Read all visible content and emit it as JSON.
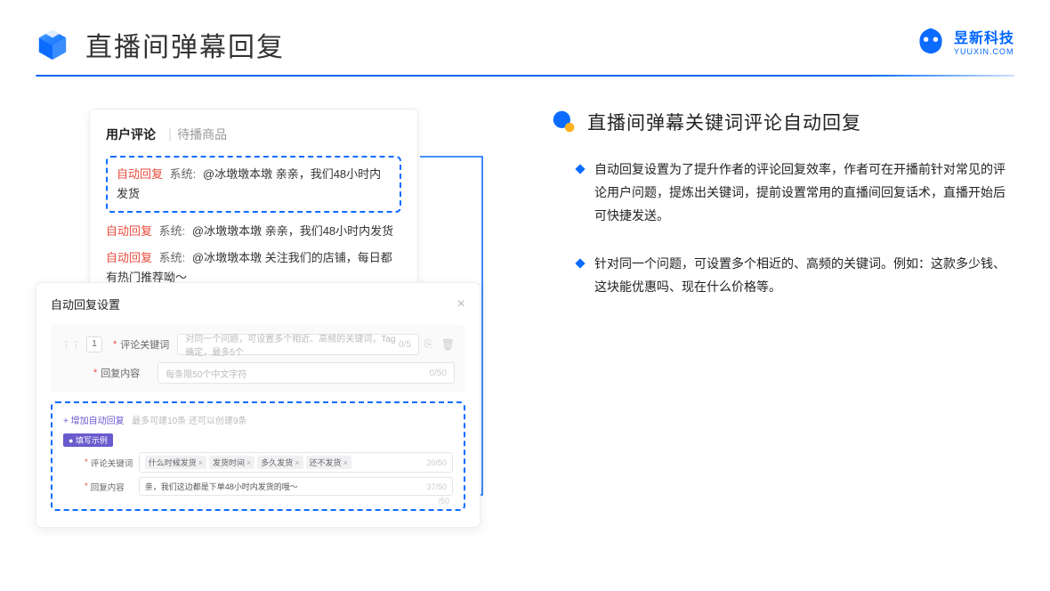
{
  "header": {
    "title": "直播间弹幕回复",
    "brand_cn": "昱新科技",
    "brand_en": "YUUXIN.COM"
  },
  "comment_panel": {
    "tab_active": "用户评论",
    "tab_other": "待播商品",
    "highlighted": {
      "auto": "自动回复",
      "sys": "系统:",
      "text": "@冰墩墩本墩 亲亲，我们48小时内发货"
    },
    "lines": [
      {
        "auto": "自动回复",
        "sys": "系统:",
        "text": "@冰墩墩本墩 亲亲，我们48小时内发货"
      },
      {
        "auto": "自动回复",
        "sys": "系统:",
        "text": "@冰墩墩本墩 关注我们的店铺，每日都有热门推荐呦～"
      }
    ]
  },
  "settings": {
    "title": "自动回复设置",
    "num": "1",
    "kw_label": "评论关键词",
    "kw_placeholder": "对同一个问题，可设置多个相近、高频的关键词，Tag确定，最多5个",
    "kw_count": "0/5",
    "content_label": "回复内容",
    "content_placeholder": "每条限50个中文字符",
    "content_count": "0/50",
    "add_link": "+ 增加自动回复",
    "add_hint": "最多可建10条 还可以创建9条",
    "example_badge": "● 填写示例",
    "ex_kw_label": "评论关键词",
    "ex_tags": [
      "什么时候发货",
      "发货时间",
      "多久发货",
      "还不发货"
    ],
    "ex_kw_count": "20/50",
    "ex_content_label": "回复内容",
    "ex_content_value": "亲，我们这边都是下单48小时内发货的哦～",
    "ex_content_count": "37/50",
    "outer_count": "/50"
  },
  "right": {
    "section_title": "直播间弹幕关键词评论自动回复",
    "bullets": [
      "自动回复设置为了提升作者的评论回复效率，作者可在开播前针对常见的评论用户问题，提炼出关键词，提前设置常用的直播间回复话术，直播开始后可快捷发送。",
      "针对同一个问题，可设置多个相近的、高频的关键词。例如：这款多少钱、这块能优惠吗、现在什么价格等。"
    ]
  }
}
